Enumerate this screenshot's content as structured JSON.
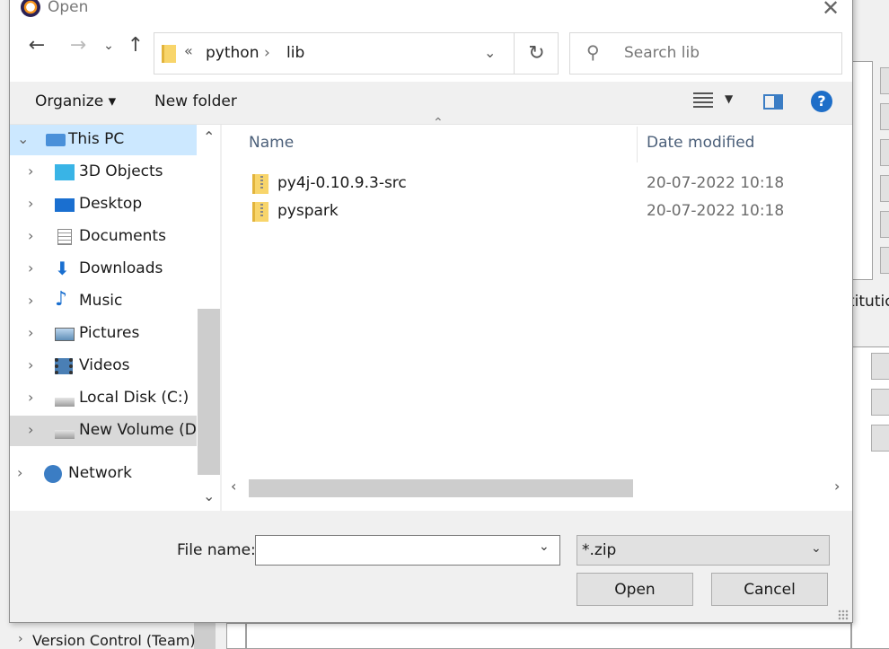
{
  "window": {
    "title": "Open"
  },
  "address": {
    "overflow": "«",
    "segments": [
      "python",
      "lib"
    ],
    "separator": "›"
  },
  "search": {
    "placeholder": "Search lib"
  },
  "toolbar": {
    "organize": "Organize ▾",
    "new_folder": "New folder",
    "help": "?"
  },
  "nav": {
    "items": [
      {
        "label": "This PC",
        "icon": "computer-icon"
      },
      {
        "label": "3D Objects",
        "icon": "cube-icon"
      },
      {
        "label": "Desktop",
        "icon": "desktop-icon"
      },
      {
        "label": "Documents",
        "icon": "document-icon"
      },
      {
        "label": "Downloads",
        "icon": "download-icon"
      },
      {
        "label": "Music",
        "icon": "music-icon"
      },
      {
        "label": "Pictures",
        "icon": "picture-icon"
      },
      {
        "label": "Videos",
        "icon": "video-icon"
      },
      {
        "label": "Local Disk (C:)",
        "icon": "drive-icon"
      },
      {
        "label": "New Volume (D:)",
        "icon": "drive-icon"
      },
      {
        "label": "Network",
        "icon": "network-icon"
      }
    ]
  },
  "files": {
    "columns": {
      "name": "Name",
      "date": "Date modified"
    },
    "rows": [
      {
        "name": "py4j-0.10.9.3-src",
        "date": "20-07-2022 10:18"
      },
      {
        "name": "pyspark",
        "date": "20-07-2022 10:18"
      }
    ]
  },
  "footer": {
    "filename_label": "File name:",
    "filename_value": "",
    "filetype": "*.zip",
    "open": "Open",
    "cancel": "Cancel"
  },
  "background": {
    "tree_item": "Version Control (Team)",
    "partial": "titutic"
  }
}
